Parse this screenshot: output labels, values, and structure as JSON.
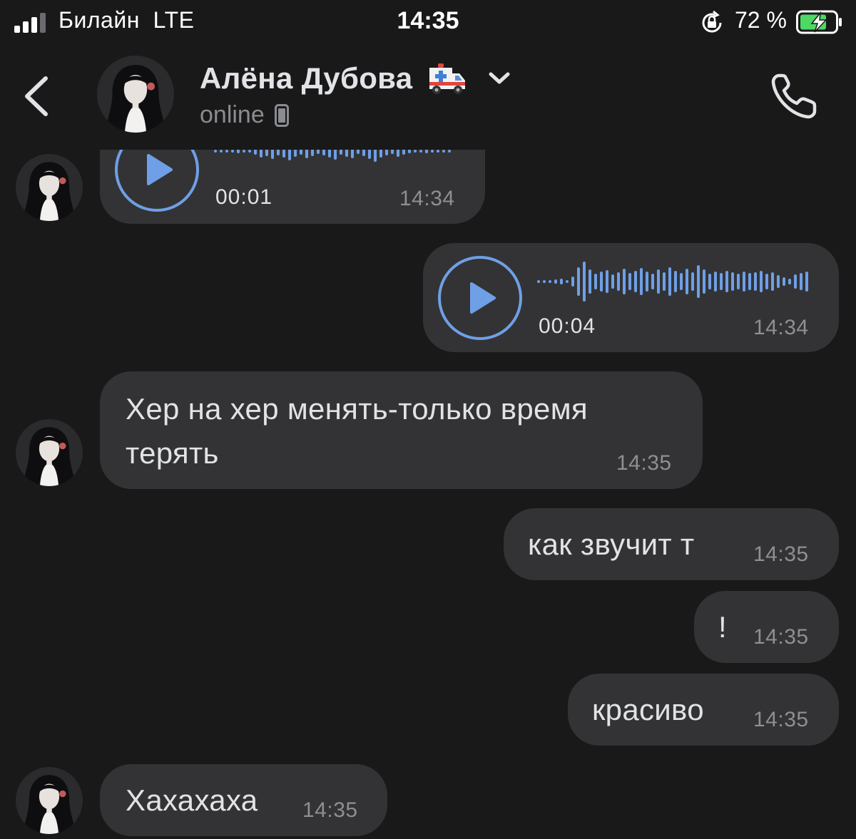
{
  "status_bar": {
    "carrier": "Билайн",
    "network": "LTE",
    "time": "14:35",
    "battery_percent": "72 %",
    "icons": [
      "signal-icon",
      "rotation-lock-icon",
      "battery-charging-icon"
    ]
  },
  "header": {
    "contact_name": "Алёна Дубова",
    "name_emoji": "ambulance-emoji",
    "presence": "online",
    "icons": [
      "back-icon",
      "chevron-down-icon",
      "mobile-device-icon",
      "phone-icon"
    ]
  },
  "messages": [
    {
      "type": "voice",
      "direction": "incoming",
      "duration": "00:01",
      "time": "14:34",
      "icon": "play-icon"
    },
    {
      "type": "voice",
      "direction": "outgoing",
      "duration": "00:04",
      "time": "14:34",
      "icon": "play-icon"
    },
    {
      "type": "text",
      "direction": "incoming",
      "lines": [
        "Хер на хер менять-только время",
        "терять"
      ],
      "time": "14:35"
    },
    {
      "type": "text",
      "direction": "outgoing",
      "text": "как звучит т",
      "time": "14:35"
    },
    {
      "type": "text",
      "direction": "outgoing",
      "text": "!",
      "time": "14:35"
    },
    {
      "type": "text",
      "direction": "outgoing",
      "text": "красиво",
      "time": "14:35"
    },
    {
      "type": "text",
      "direction": "incoming",
      "text": "Хахахаха",
      "time": "14:35"
    }
  ],
  "colors": {
    "background": "#19191a",
    "bubble": "#333335",
    "text": "#e1e3e6",
    "secondary_text": "#8d8f93",
    "accent": "#6f9fe6",
    "battery_green": "#4cd964"
  }
}
